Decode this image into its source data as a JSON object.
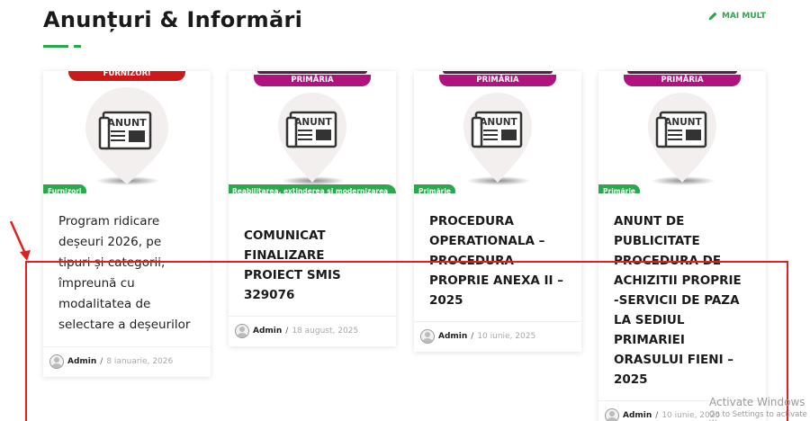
{
  "section": {
    "title": "Anunțuri & Informări",
    "more_label": "MAI MULT"
  },
  "cards": [
    {
      "ribbon": "FURNIZORI",
      "ribbon_color": "#cc1a1a",
      "pin_label": "ANUNT",
      "category": "Furnizori",
      "title": "Program ridicare deșeuri 2026, pe tipuri și categorii, împreună cu modalitatea de selectare a deșeurilor",
      "author": "Admin",
      "date": "8 ianuarie, 2026"
    },
    {
      "ribbon": "PRIMĂRIA",
      "ribbon_color": "#b0127e",
      "pin_label": "ANUNT",
      "category": "Reabilitarea, extinderea și modernizarea Școlii Gimnaziale",
      "title": "COMUNICAT FINALIZARE PROIECT SMIS 329076",
      "author": "Admin",
      "date": "18 august, 2025"
    },
    {
      "ribbon": "PRIMĂRIA",
      "ribbon_color": "#b0127e",
      "pin_label": "ANUNT",
      "category": "Primărie",
      "title": "PROCEDURA OPERATIONALA – PROCEDURA PROPRIE ANEXA II – 2025",
      "author": "Admin",
      "date": "10 iunie, 2025"
    },
    {
      "ribbon": "PRIMĂRIA",
      "ribbon_color": "#b0127e",
      "pin_label": "ANUNT",
      "category": "Primărie",
      "title": "ANUNT DE PUBLICITATE PROCEDURA DE ACHIZITII PROPRIE -SERVICII DE PAZA LA SEDIUL PRIMARIEI ORASULUI FIENI – 2025",
      "author": "Admin",
      "date": "10 iunie, 2025"
    }
  ],
  "watermark": {
    "line1": "Activate Windows",
    "line2": "Go to Settings to activate W"
  },
  "colors": {
    "accent": "#2ca84c",
    "annotation": "#e02020"
  }
}
